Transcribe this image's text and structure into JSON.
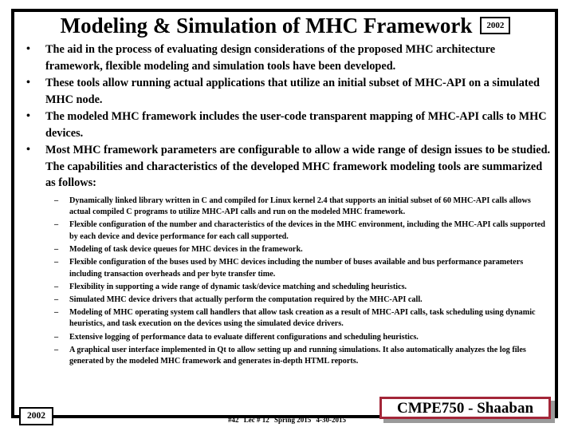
{
  "slide": {
    "title": "Modeling & Simulation of MHC Framework",
    "title_year_badge": "2002",
    "bullet_marker": "•",
    "dash_marker": "–",
    "bullets": [
      "The aid in the process  of evaluating design considerations of  the proposed MHC architecture framework, flexible modeling and simulation tools have been developed.",
      "These tools allow running actual applications that utilize an initial subset of MHC-API on a simulated MHC node.",
      "The modeled MHC framework includes the user-code transparent mapping of MHC-API calls to MHC devices.",
      "Most MHC framework parameters are configurable to allow a wide range of design issues to be studied. The capabilities and characteristics of the developed MHC framework modeling tools are summarized as follows:"
    ],
    "sub_bullets": [
      "Dynamically linked library written in C and compiled for Linux kernel 2.4  that supports an initial  subset of 60 MHC-API calls allows actual compiled  C programs to utilize MHC-API calls and run on the modeled MHC framework.",
      "Flexible configuration of the number and characteristics of  the devices in the MHC environment,  including the MHC-API calls supported by each device and  device performance for each call supported.",
      "Modeling of task device queues for MHC devices in the framework.",
      "Flexible configuration of the buses used by MHC devices including the number of buses available and bus performance parameters including transaction overheads and per byte transfer time.",
      "Flexibility in supporting  a wide range of dynamic  task/device  matching and  scheduling heuristics.",
      "Simulated MHC device drivers that actually perform the computation required by the MHC-API call.",
      "Modeling of MHC operating system call handlers that allow  task creation as a result of MHC-API calls, task scheduling using  dynamic heuristics, and task execution on the devices using the simulated device drivers.",
      "Extensive logging of performance data  to evaluate different configurations and scheduling heuristics.",
      "A graphical user interface implemented in Qt to allow setting up and running simulations. It also automatically analyzes the log files generated by the modeled MHC  framework and generates in-depth HTML reports."
    ]
  },
  "footer": {
    "year_badge": "2002",
    "slide_number": "#42",
    "lecture": "Lec # 12",
    "term": "Spring 2015",
    "date": "4-30-2015",
    "course_badge": "CMPE750 - Shaaban"
  },
  "colors": {
    "frame": "#000000",
    "text": "#000000",
    "badge_border": "#a32638",
    "badge_shadow": "#9a9a9a",
    "background": "#ffffff"
  }
}
